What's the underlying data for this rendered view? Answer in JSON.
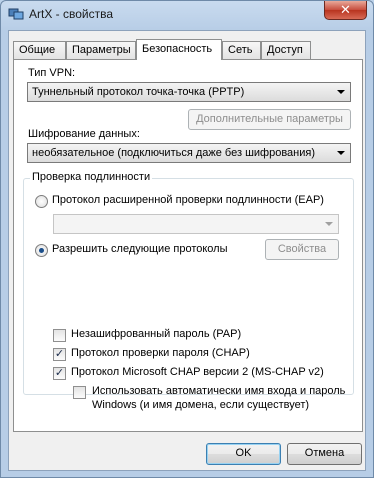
{
  "window": {
    "title": "ArtX - свойства",
    "close_symbol": "✕"
  },
  "tabs": [
    {
      "label": "Общие",
      "active": false
    },
    {
      "label": "Параметры",
      "active": false
    },
    {
      "label": "Безопасность",
      "active": true
    },
    {
      "label": "Сеть",
      "active": false
    },
    {
      "label": "Доступ",
      "active": false
    }
  ],
  "vpn": {
    "label": "Тип VPN:",
    "selected": "Туннельный протокол точка-точка (PPTP)",
    "advanced_button": "Дополнительные параметры"
  },
  "encryption": {
    "label": "Шифрование данных:",
    "selected": "необязательное (подключиться даже без шифрования)"
  },
  "auth": {
    "group_title": "Проверка подлинности",
    "eap_radio": "Протокол расширенной проверки подлинности (EAP)",
    "eap_selected": "",
    "allow_radio": "Разрешить следующие протоколы",
    "properties_button": "Свойства",
    "protocols": [
      {
        "label": "Незашифрованный пароль (PAP)",
        "checked": false
      },
      {
        "label": "Протокол проверки пароля (CHAP)",
        "checked": true
      },
      {
        "label": "Протокол Microsoft CHAP версии 2 (MS-CHAP v2)",
        "checked": true
      }
    ],
    "auto_login_line1": "Использовать автоматически имя входа и пароль",
    "auto_login_line2": "Windows (и имя домена, если существует)",
    "auto_login_checked": false
  },
  "footer": {
    "ok": "OK",
    "cancel": "Отмена"
  },
  "check_mark": "✓"
}
